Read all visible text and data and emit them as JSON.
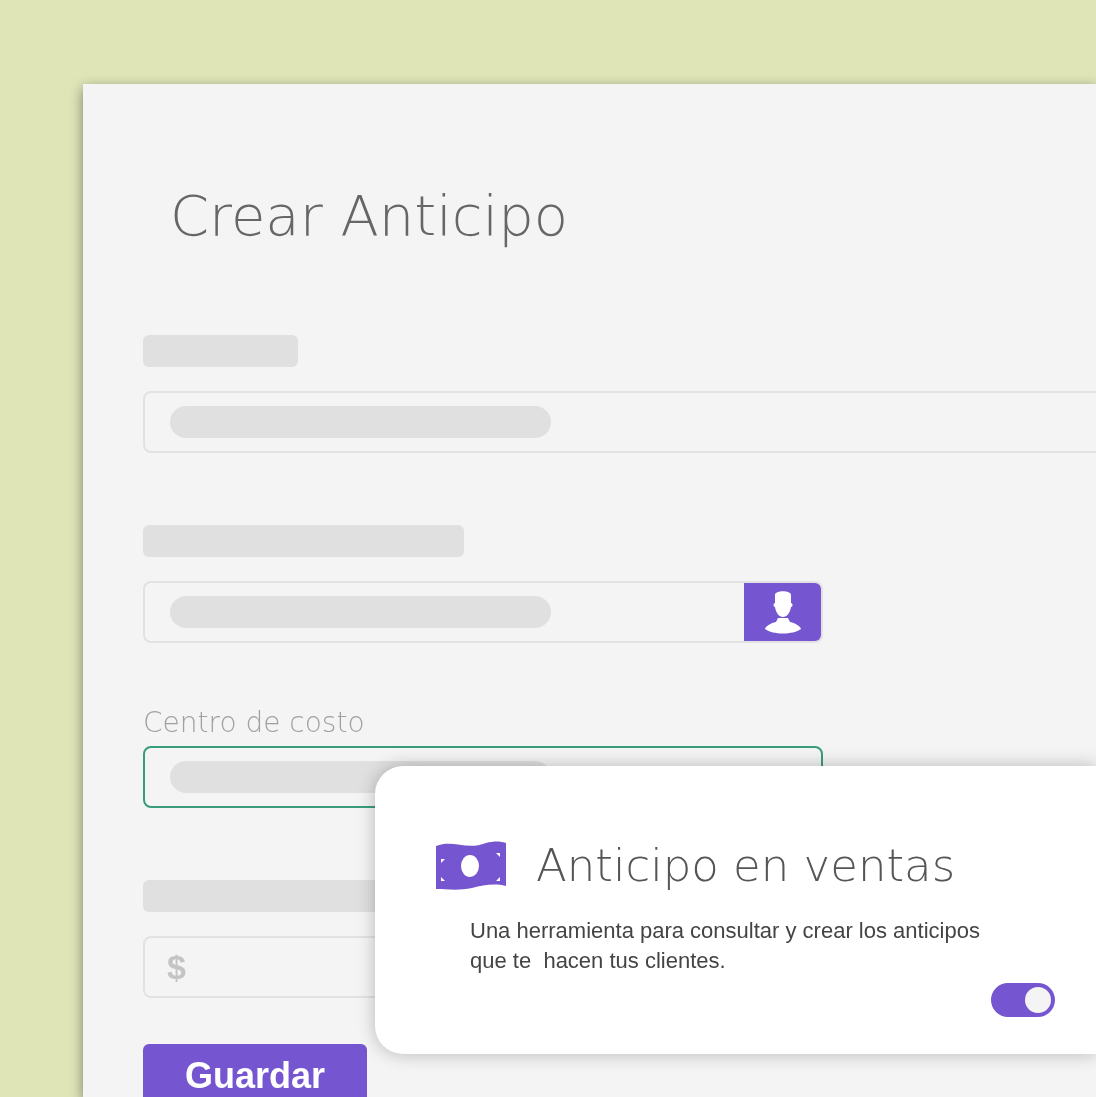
{
  "form": {
    "title": "Crear Anticipo",
    "fields": [
      {
        "kind": "text",
        "focused": false
      },
      {
        "kind": "contact",
        "focused": false
      },
      {
        "kind": "select",
        "label": "Centro de costo",
        "focused": true
      },
      {
        "kind": "amount",
        "prefix": "$",
        "focused": false
      }
    ],
    "submit": "Guardar"
  },
  "feature_card": {
    "title": "Anticipo en ventas",
    "description": "Una herramienta para consultar y crear los anticipos que te  hacen tus clientes.",
    "on": true
  }
}
